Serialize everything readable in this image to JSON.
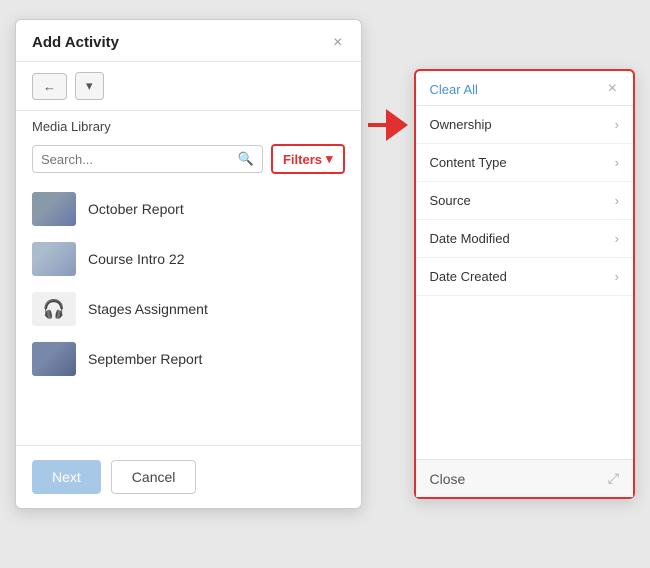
{
  "dialog": {
    "title": "Add Activity",
    "close_label": "×",
    "back_icon": "←",
    "dropdown_icon": "▾",
    "section_label": "Media Library",
    "search_placeholder": "Search...",
    "filters_label": "Filters",
    "filters_dropdown_icon": "▾",
    "media_items": [
      {
        "id": 1,
        "title": "October Report",
        "type": "image"
      },
      {
        "id": 2,
        "title": "Course Intro 22",
        "type": "image"
      },
      {
        "id": 3,
        "title": "Stages Assignment",
        "type": "audio"
      },
      {
        "id": 4,
        "title": "September Report",
        "type": "image"
      }
    ],
    "footer": {
      "next_label": "Next",
      "cancel_label": "Cancel"
    }
  },
  "filter_panel": {
    "clear_all_label": "Clear All",
    "close_icon": "×",
    "items": [
      {
        "label": "Ownership"
      },
      {
        "label": "Content Type"
      },
      {
        "label": "Source"
      },
      {
        "label": "Date Modified"
      },
      {
        "label": "Date Created"
      }
    ],
    "close_button_label": "Close",
    "resize_icon": "⤢"
  }
}
